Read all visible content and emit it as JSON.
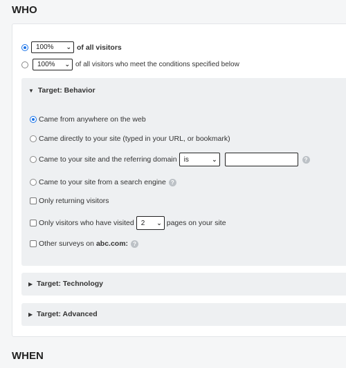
{
  "sections": {
    "who": "WHO",
    "when": "WHEN"
  },
  "visitor_scope": {
    "option_all": {
      "percent": "100%",
      "label": "of all visitors",
      "selected": true
    },
    "option_conditions": {
      "percent": "100%",
      "label": "of all visitors who meet the conditions specified below",
      "selected": false
    }
  },
  "behavior": {
    "title": "Target: Behavior",
    "options": {
      "anywhere": "Came from anywhere on the web",
      "direct": "Came directly to your site (typed in your URL, or bookmark)",
      "referring": "Came to your site and the referring domain",
      "referring_operator": "is",
      "search_engine": "Came to your site from a search engine",
      "returning": "Only returning visitors",
      "visited_prefix": "Only visitors who have visited",
      "visited_count": "2",
      "visited_suffix": "pages on your site",
      "other_surveys_prefix": "Other surveys on",
      "other_surveys_domain": "abc.com:"
    }
  },
  "technology": {
    "title": "Target: Technology"
  },
  "advanced": {
    "title": "Target: Advanced"
  },
  "icons": {
    "help": "?",
    "chevron": "❯",
    "expanded": "▼",
    "collapsed": "▶"
  },
  "colors": {
    "radio_selected": "#1a73e8",
    "panel_bg": "#eef0f2"
  }
}
